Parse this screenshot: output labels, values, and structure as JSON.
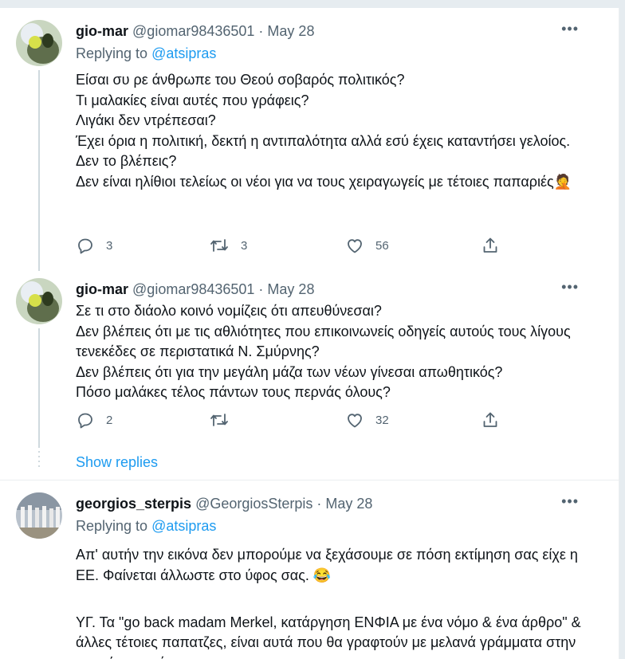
{
  "tweets": [
    {
      "name": "gio-mar",
      "handle": "@giomar98436501",
      "sep": " · ",
      "date": "May 28",
      "replying_label": "Replying to",
      "replying_to": "@atsipras",
      "lines": [
        "Είσαι συ ρε άνθρωπε του Θεού σοβαρός πολιτικός?",
        "Τι μαλακίες είναι αυτές που γράφεις?",
        "Λιγάκι δεν ντρέπεσαι?",
        "Έχει όρια η πολιτική, δεκτή η αντιπαλότητα αλλά εσύ έχεις καταντήσει γελοίος.",
        "Δεν το βλέπεις?",
        "Δεν είναι ηλίθιοι τελείως οι νέοι για να τους χειραγωγείς με τέτοιες παπαριές🤦"
      ],
      "replies": "3",
      "retweets": "3",
      "likes": "56"
    },
    {
      "name": "gio-mar",
      "handle": "@giomar98436501",
      "sep": " · ",
      "date": "May 28",
      "lines": [
        "Σε τι στο διάολο κοινό νομίζεις ότι απευθύνεσαι?",
        "Δεν βλέπεις ότι με τις αθλιότητες που επικοινωνείς οδηγείς αυτούς τους λίγους τενεκέδες σε περιστατικά Ν. Σμύρνης?",
        "Δεν βλέπεις ότι για την μεγάλη μάζα των νέων γίνεσαι απωθητικός?",
        "Πόσο μαλάκες τέλος πάντων τους περνάς όλους?"
      ],
      "replies": "2",
      "retweets": "",
      "likes": "32"
    },
    {
      "name": "georgios_sterpis",
      "handle": "@GeorgiosSterpis",
      "sep": " · ",
      "date": "May 28",
      "replying_label": "Replying to",
      "replying_to": "@atsipras",
      "lines": [
        "Απ' αυτήν την εικόνα δεν μπορούμε να ξεχάσουμε σε πόση εκτίμηση σας είχε η ΕΕ. Φαίνεται άλλωστε στο ύφος σας. 😂",
        "",
        "ΥΓ. Τα \"go back madam Merkel, κατάργηση ΕΝΦΙΑ με ένα νόμο & ένα άρθρο\" & άλλες τέτοιες παπατζες, είναι αυτά που θα γραφτούν με μελανά γράμματα στην ιστορία της χώρας."
      ]
    }
  ],
  "more_glyph": "•••",
  "show_replies": "Show replies",
  "icons": [
    "reply-icon",
    "retweet-icon",
    "like-icon",
    "share-icon",
    "more-icon"
  ],
  "colors": {
    "link": "#1d9bf0",
    "secondary": "#536471",
    "text": "#0f1419"
  }
}
